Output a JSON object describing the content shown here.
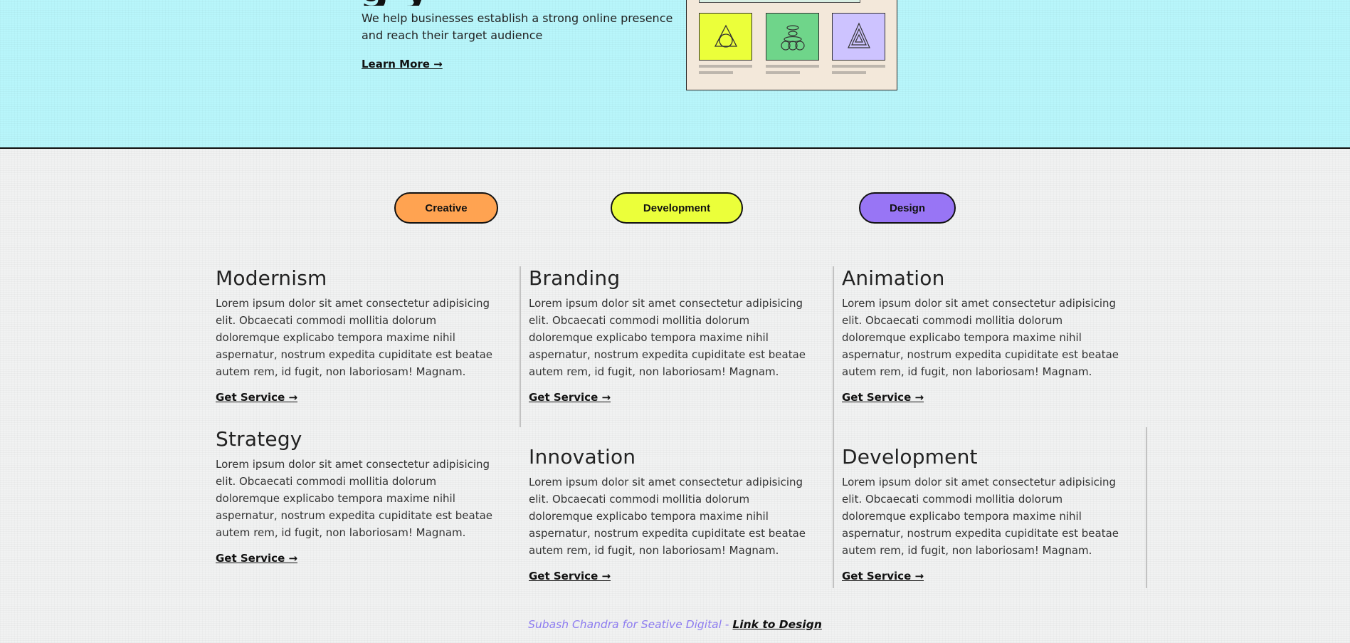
{
  "hero": {
    "title_partial": "g y",
    "subtitle": "We help businesses establish a strong online presence and reach their target audience",
    "learn_more": "Learn More →"
  },
  "categories": [
    {
      "label": "Creative",
      "color": "#ffa351"
    },
    {
      "label": "Development",
      "color": "#ebff3a"
    },
    {
      "label": "Design",
      "color": "#9875f5"
    }
  ],
  "services": [
    {
      "title": "Modernism",
      "text": "Lorem ipsum dolor sit amet consectetur adipisicing elit. Obcaecati commodi mollitia dolorum doloremque explicabo tempora maxime nihil aspernatur, nostrum expedita cupiditate est beatae autem rem, id fugit, non laboriosam! Magnam.",
      "link": "Get Service →"
    },
    {
      "title": "Branding",
      "text": "Lorem ipsum dolor sit amet consectetur adipisicing elit. Obcaecati commodi mollitia dolorum doloremque explicabo tempora maxime nihil aspernatur, nostrum expedita cupiditate est beatae autem rem, id fugit, non laboriosam! Magnam.",
      "link": "Get Service →"
    },
    {
      "title": "Animation",
      "text": "Lorem ipsum dolor sit amet consectetur adipisicing elit. Obcaecati commodi mollitia dolorum doloremque explicabo tempora maxime nihil aspernatur, nostrum expedita cupiditate est beatae autem rem, id fugit, non laboriosam! Magnam.",
      "link": "Get Service →"
    },
    {
      "title": "Strategy",
      "text": "Lorem ipsum dolor sit amet consectetur adipisicing elit. Obcaecati commodi mollitia dolorum doloremque explicabo tempora maxime nihil aspernatur, nostrum expedita cupiditate est beatae autem rem, id fugit, non laboriosam! Magnam.",
      "link": "Get Service →"
    },
    {
      "title": "Innovation",
      "text": "Lorem ipsum dolor sit amet consectetur adipisicing elit. Obcaecati commodi mollitia dolorum doloremque explicabo tempora maxime nihil aspernatur, nostrum expedita cupiditate est beatae autem rem, id fugit, non laboriosam! Magnam.",
      "link": "Get Service →"
    },
    {
      "title": "Development",
      "text": "Lorem ipsum dolor sit amet consectetur adipisicing elit. Obcaecati commodi mollitia dolorum doloremque explicabo tempora maxime nihil aspernatur, nostrum expedita cupiditate est beatae autem rem, id fugit, non laboriosam! Magnam.",
      "link": "Get Service →"
    }
  ],
  "illustration": {
    "card_colors": [
      "#ebff3a",
      "#6fd58a",
      "#cdc3ff"
    ],
    "icons": [
      "triangle-circle-icon",
      "stacked-ovals-icon",
      "nested-triangles-icon"
    ]
  },
  "footer": {
    "credit": "Subash Chandra for Seative Digital",
    "separator": " - ",
    "link": "Link to Design"
  }
}
